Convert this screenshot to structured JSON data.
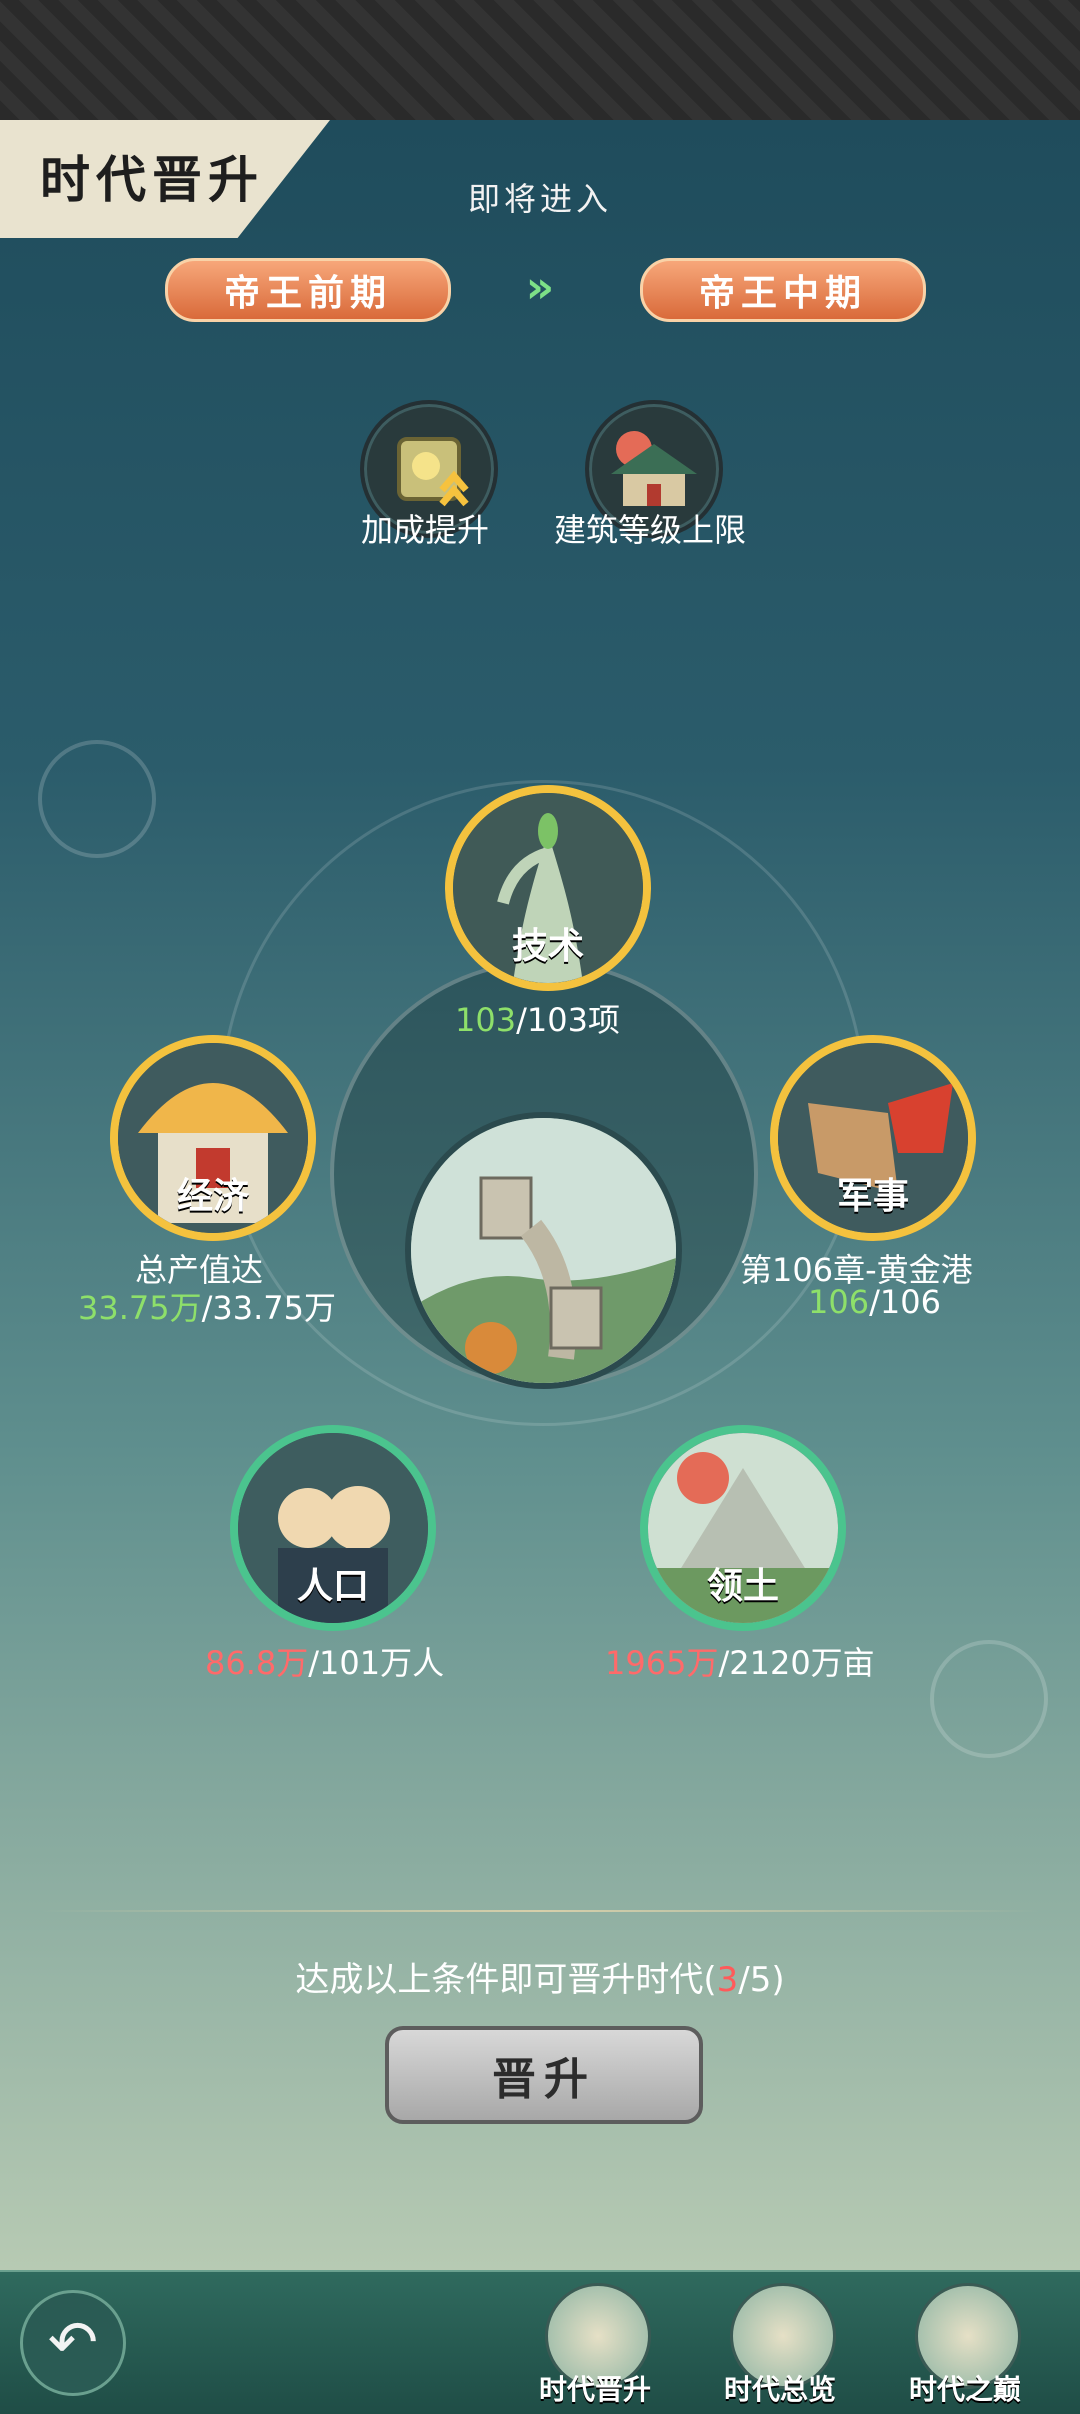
{
  "header": {
    "title": "时代晋升",
    "subtitle": "即将进入",
    "era_from": "帝王前期",
    "era_to": "帝王中期",
    "arrows": "»"
  },
  "benefits": [
    {
      "label": "加成提升",
      "icon": "bonus-up-icon"
    },
    {
      "label": "建筑等级上限",
      "icon": "building-level-icon"
    }
  ],
  "conditions": {
    "tech": {
      "label": "技术",
      "current": "103",
      "rest": "/103项"
    },
    "economy": {
      "label": "经济",
      "line1": "总产值达",
      "current": "33.75万",
      "rest": "/33.75万"
    },
    "military": {
      "label": "军事",
      "line1": "第106章-黄金港",
      "current": "106",
      "rest": "/106"
    },
    "population": {
      "label": "人口",
      "current": "86.8万",
      "rest": "/101万人"
    },
    "territory": {
      "label": "领土",
      "current": "1965万",
      "rest": "/2120万亩"
    }
  },
  "footer": {
    "condition_prefix": "达成以上条件即可晋升时代(",
    "condition_done": "3",
    "condition_suffix": "/5)",
    "promote_label": "晋升"
  },
  "nav": [
    {
      "label": "时代晋升"
    },
    {
      "label": "时代总览"
    },
    {
      "label": "时代之巅"
    }
  ],
  "colors": {
    "complete": "#8ee06a",
    "incomplete": "#ff6a6a",
    "gold_ring": "#f4c23e",
    "green_ring": "#4bc48e",
    "era_tag": "#d96a3a"
  }
}
